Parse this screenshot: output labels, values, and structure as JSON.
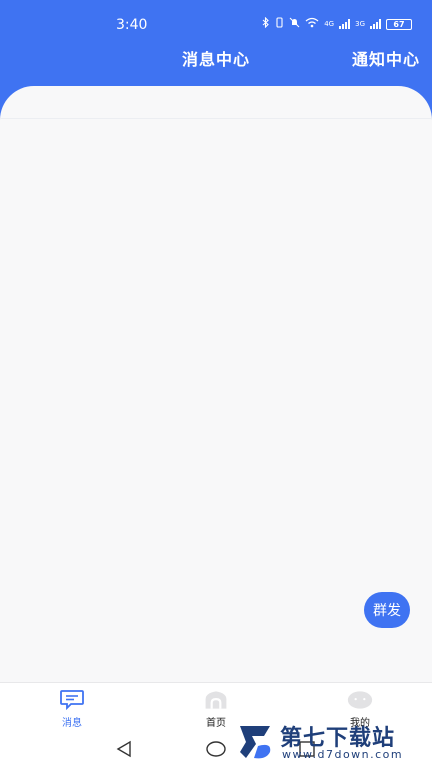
{
  "status_bar": {
    "time": "3:40",
    "battery": "67",
    "net1": "4G",
    "net2": "3G"
  },
  "header": {
    "title": "消息中心",
    "notify_label": "通知中心"
  },
  "fab": {
    "label": "群发"
  },
  "tabs": [
    {
      "label": "消息",
      "icon": "message-icon",
      "active": true
    },
    {
      "label": "首页",
      "icon": "home-icon",
      "active": false
    },
    {
      "label": "我的",
      "icon": "profile-icon",
      "active": false
    }
  ],
  "watermark": {
    "title": "第七下载站",
    "url": "www.d7down.com"
  },
  "colors": {
    "accent": "#3f73f2",
    "background": "#f8f8f9"
  }
}
